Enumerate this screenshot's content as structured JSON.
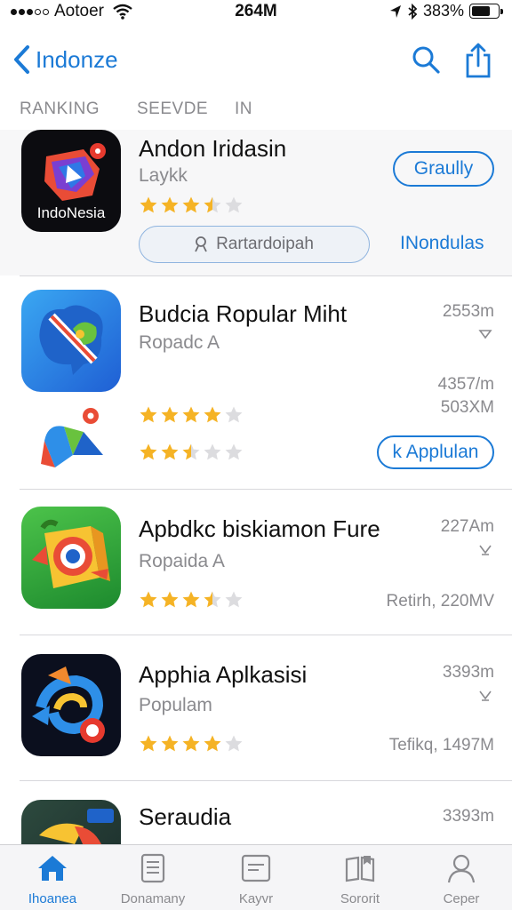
{
  "status_bar": {
    "carrier": "Aotoer",
    "time": "264M",
    "battery": "383%"
  },
  "nav": {
    "back_label": "Indonze"
  },
  "tabs": [
    "RANKING",
    "SEEVDE",
    "IN"
  ],
  "apps": [
    {
      "title": "Andon Iridasin",
      "subtitle": "Laykk",
      "rating": 3.5,
      "action_label": "Graully",
      "search_label": "Rartardoipah",
      "link_label": "INondulas",
      "icon_text": "IndoNesia"
    },
    {
      "title": "Budcia  Ropular Miht",
      "subtitle": "Ropadc A",
      "rating_a": 4,
      "rating_b": 2.5,
      "meta_1": "2553m",
      "meta_2": "4357/m",
      "meta_3": "503XM",
      "action_label": "k  Applulan"
    },
    {
      "title": "Apbdkc biskiamon Fure",
      "subtitle": "Ropaida A",
      "rating": 3.5,
      "meta_1": "227Am",
      "meta_2": "Retirh, 220MV"
    },
    {
      "title": "Apphia Aplkasisi",
      "subtitle": "Populam",
      "rating": 4,
      "meta_1": "3393m",
      "meta_2": "Tefikq, 1497M"
    },
    {
      "title": "Seraudia",
      "meta_1": "3393m"
    }
  ],
  "tabbar": [
    "Ihoanea",
    "Donamany",
    "Kayvr",
    "Sororit",
    "Ceper"
  ],
  "colors": {
    "accent": "#1b7ad6",
    "star": "#f5b325",
    "star_empty": "#dcdcdf"
  }
}
